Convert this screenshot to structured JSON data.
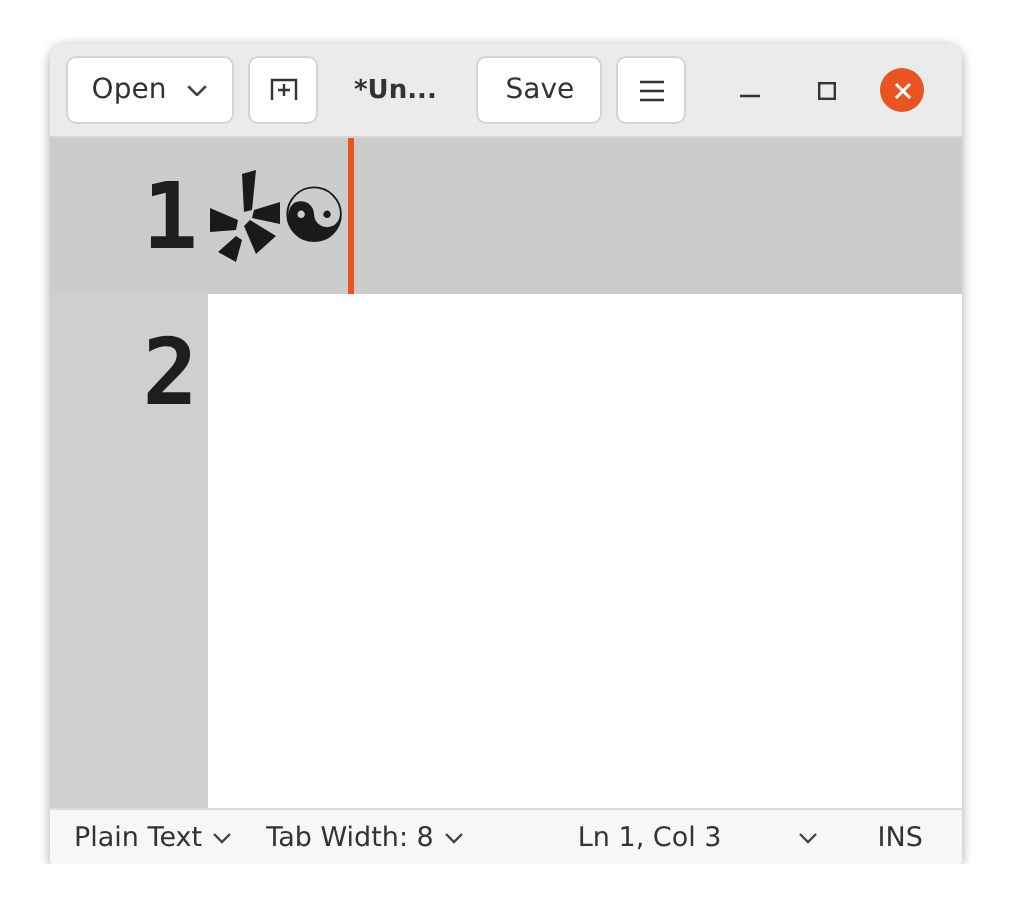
{
  "header": {
    "open_button": "Open",
    "title": "*Un...",
    "save_button": "Save"
  },
  "lines": [
    {
      "number": "1",
      "kind": "glyph_line",
      "text": "☯",
      "current": true,
      "cursor": true
    },
    {
      "number": "2",
      "kind": "empty",
      "current": false,
      "cursor": false
    }
  ],
  "status_bar": {
    "language": "Plain Text",
    "tab_width": "Tab Width: 8",
    "position": "Ln 1, Col 3",
    "mode": "INS"
  }
}
